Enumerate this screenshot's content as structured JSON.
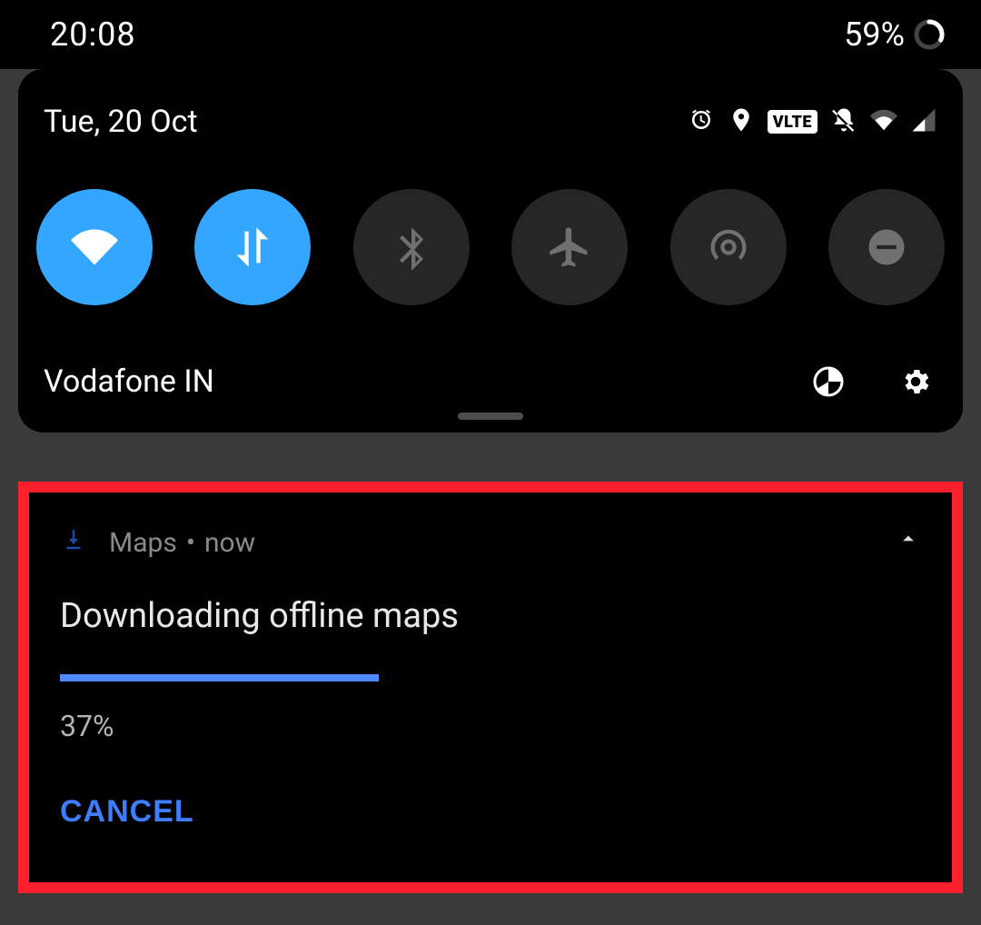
{
  "statusbar": {
    "time": "20:08",
    "battery_percent": "59%"
  },
  "qs": {
    "date": "Tue, 20 Oct",
    "status_icons": [
      "alarm",
      "location",
      "volte",
      "mute",
      "wifi-small",
      "signal"
    ],
    "tiles": [
      {
        "name": "wifi",
        "active": true
      },
      {
        "name": "data",
        "active": true
      },
      {
        "name": "bluetooth",
        "active": false
      },
      {
        "name": "airplane",
        "active": false
      },
      {
        "name": "hotspot",
        "active": false
      },
      {
        "name": "dnd",
        "active": false
      }
    ],
    "carrier": "Vodafone IN",
    "volte_label": "V⁠LTE"
  },
  "notification": {
    "app": "Maps",
    "when": "now",
    "title": "Downloading offline maps",
    "progress_percent": 37,
    "progress_label": "37%",
    "actions": {
      "cancel": "CANCEL"
    }
  },
  "colors": {
    "accent": "#33a7ff",
    "progress": "#4f88ff",
    "highlight": "#ff1f2d"
  }
}
